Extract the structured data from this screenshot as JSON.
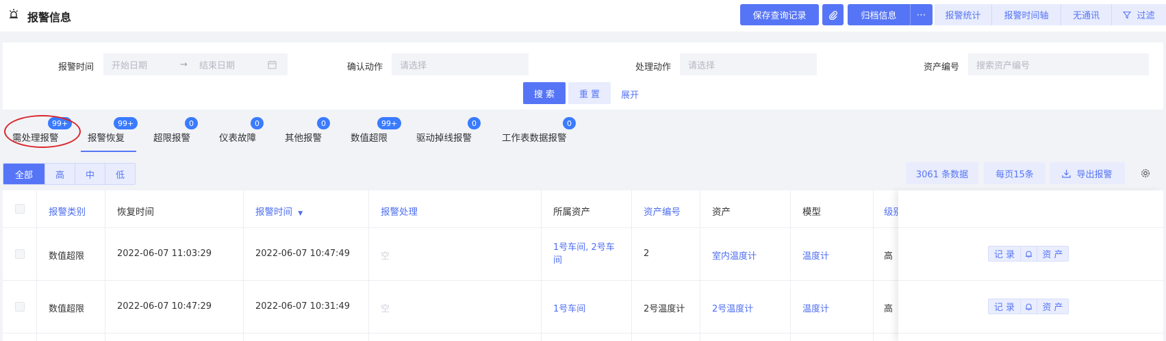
{
  "header": {
    "title": "报警信息",
    "title_icon": "alarm-bell-icon",
    "save_query_label": "保存查询记录",
    "attach_icon": "paperclip-icon",
    "archive_label": "归档信息",
    "more_icon": "ellipsis-icon",
    "stats_label": "报警统计",
    "timeline_label": "报警时间轴",
    "no_comm_label": "无通讯",
    "filter_label": "过滤",
    "filter_icon": "funnel-icon"
  },
  "filters": {
    "alarm_time_label": "报警时间",
    "start_placeholder": "开始日期",
    "end_placeholder": "结束日期",
    "confirm_action_label": "确认动作",
    "confirm_action_placeholder": "请选择",
    "handle_action_label": "处理动作",
    "handle_action_placeholder": "请选择",
    "asset_no_label": "资产编号",
    "asset_no_placeholder": "搜索资产编号",
    "search_label": "搜 索",
    "reset_label": "重 置",
    "expand_label": "展开"
  },
  "tabs": [
    {
      "label": "需处理报警",
      "badge": "99+"
    },
    {
      "label": "报警恢复",
      "badge": "99+"
    },
    {
      "label": "超限报警",
      "badge": "0"
    },
    {
      "label": "仪表故障",
      "badge": "0"
    },
    {
      "label": "其他报警",
      "badge": "0"
    },
    {
      "label": "数值超限",
      "badge": "99+"
    },
    {
      "label": "驱动掉线报警",
      "badge": "0"
    },
    {
      "label": "工作表数据报警",
      "badge": "0"
    }
  ],
  "levels": {
    "all": "全部",
    "high": "高",
    "mid": "中",
    "low": "低"
  },
  "toolbar": {
    "count_label": "3061 条数据",
    "page_size_label": "每页15条",
    "export_label": "导出报警"
  },
  "table": {
    "columns": [
      "报警类别",
      "恢复时间",
      "报警时间",
      "报警处理",
      "所属资产",
      "资产编号",
      "资产",
      "模型",
      "级别"
    ],
    "rows": [
      {
        "category": "数值超限",
        "recover_time": "2022-06-07 11:03:29",
        "alarm_time": "2022-06-07 10:47:49",
        "handling": "空",
        "belong_asset": "1号车间, 2号车间",
        "asset_no": "2",
        "asset": "室内温度计",
        "model": "温度计",
        "level": "高"
      },
      {
        "category": "数值超限",
        "recover_time": "2022-06-07 10:47:29",
        "alarm_time": "2022-06-07 10:31:49",
        "handling": "空",
        "belong_asset": "1号车间",
        "asset_no": "2号温度计",
        "asset": "2号温度计",
        "model": "温度计",
        "level": "高"
      }
    ],
    "ops": {
      "record": "记 录",
      "bell_icon": "bell-icon",
      "asset": "资 产"
    }
  },
  "colors": {
    "accent": "#5675f6",
    "accent_light": "#e8ecfd",
    "badge": "#3a7bff",
    "annotation": "#d9262b"
  }
}
